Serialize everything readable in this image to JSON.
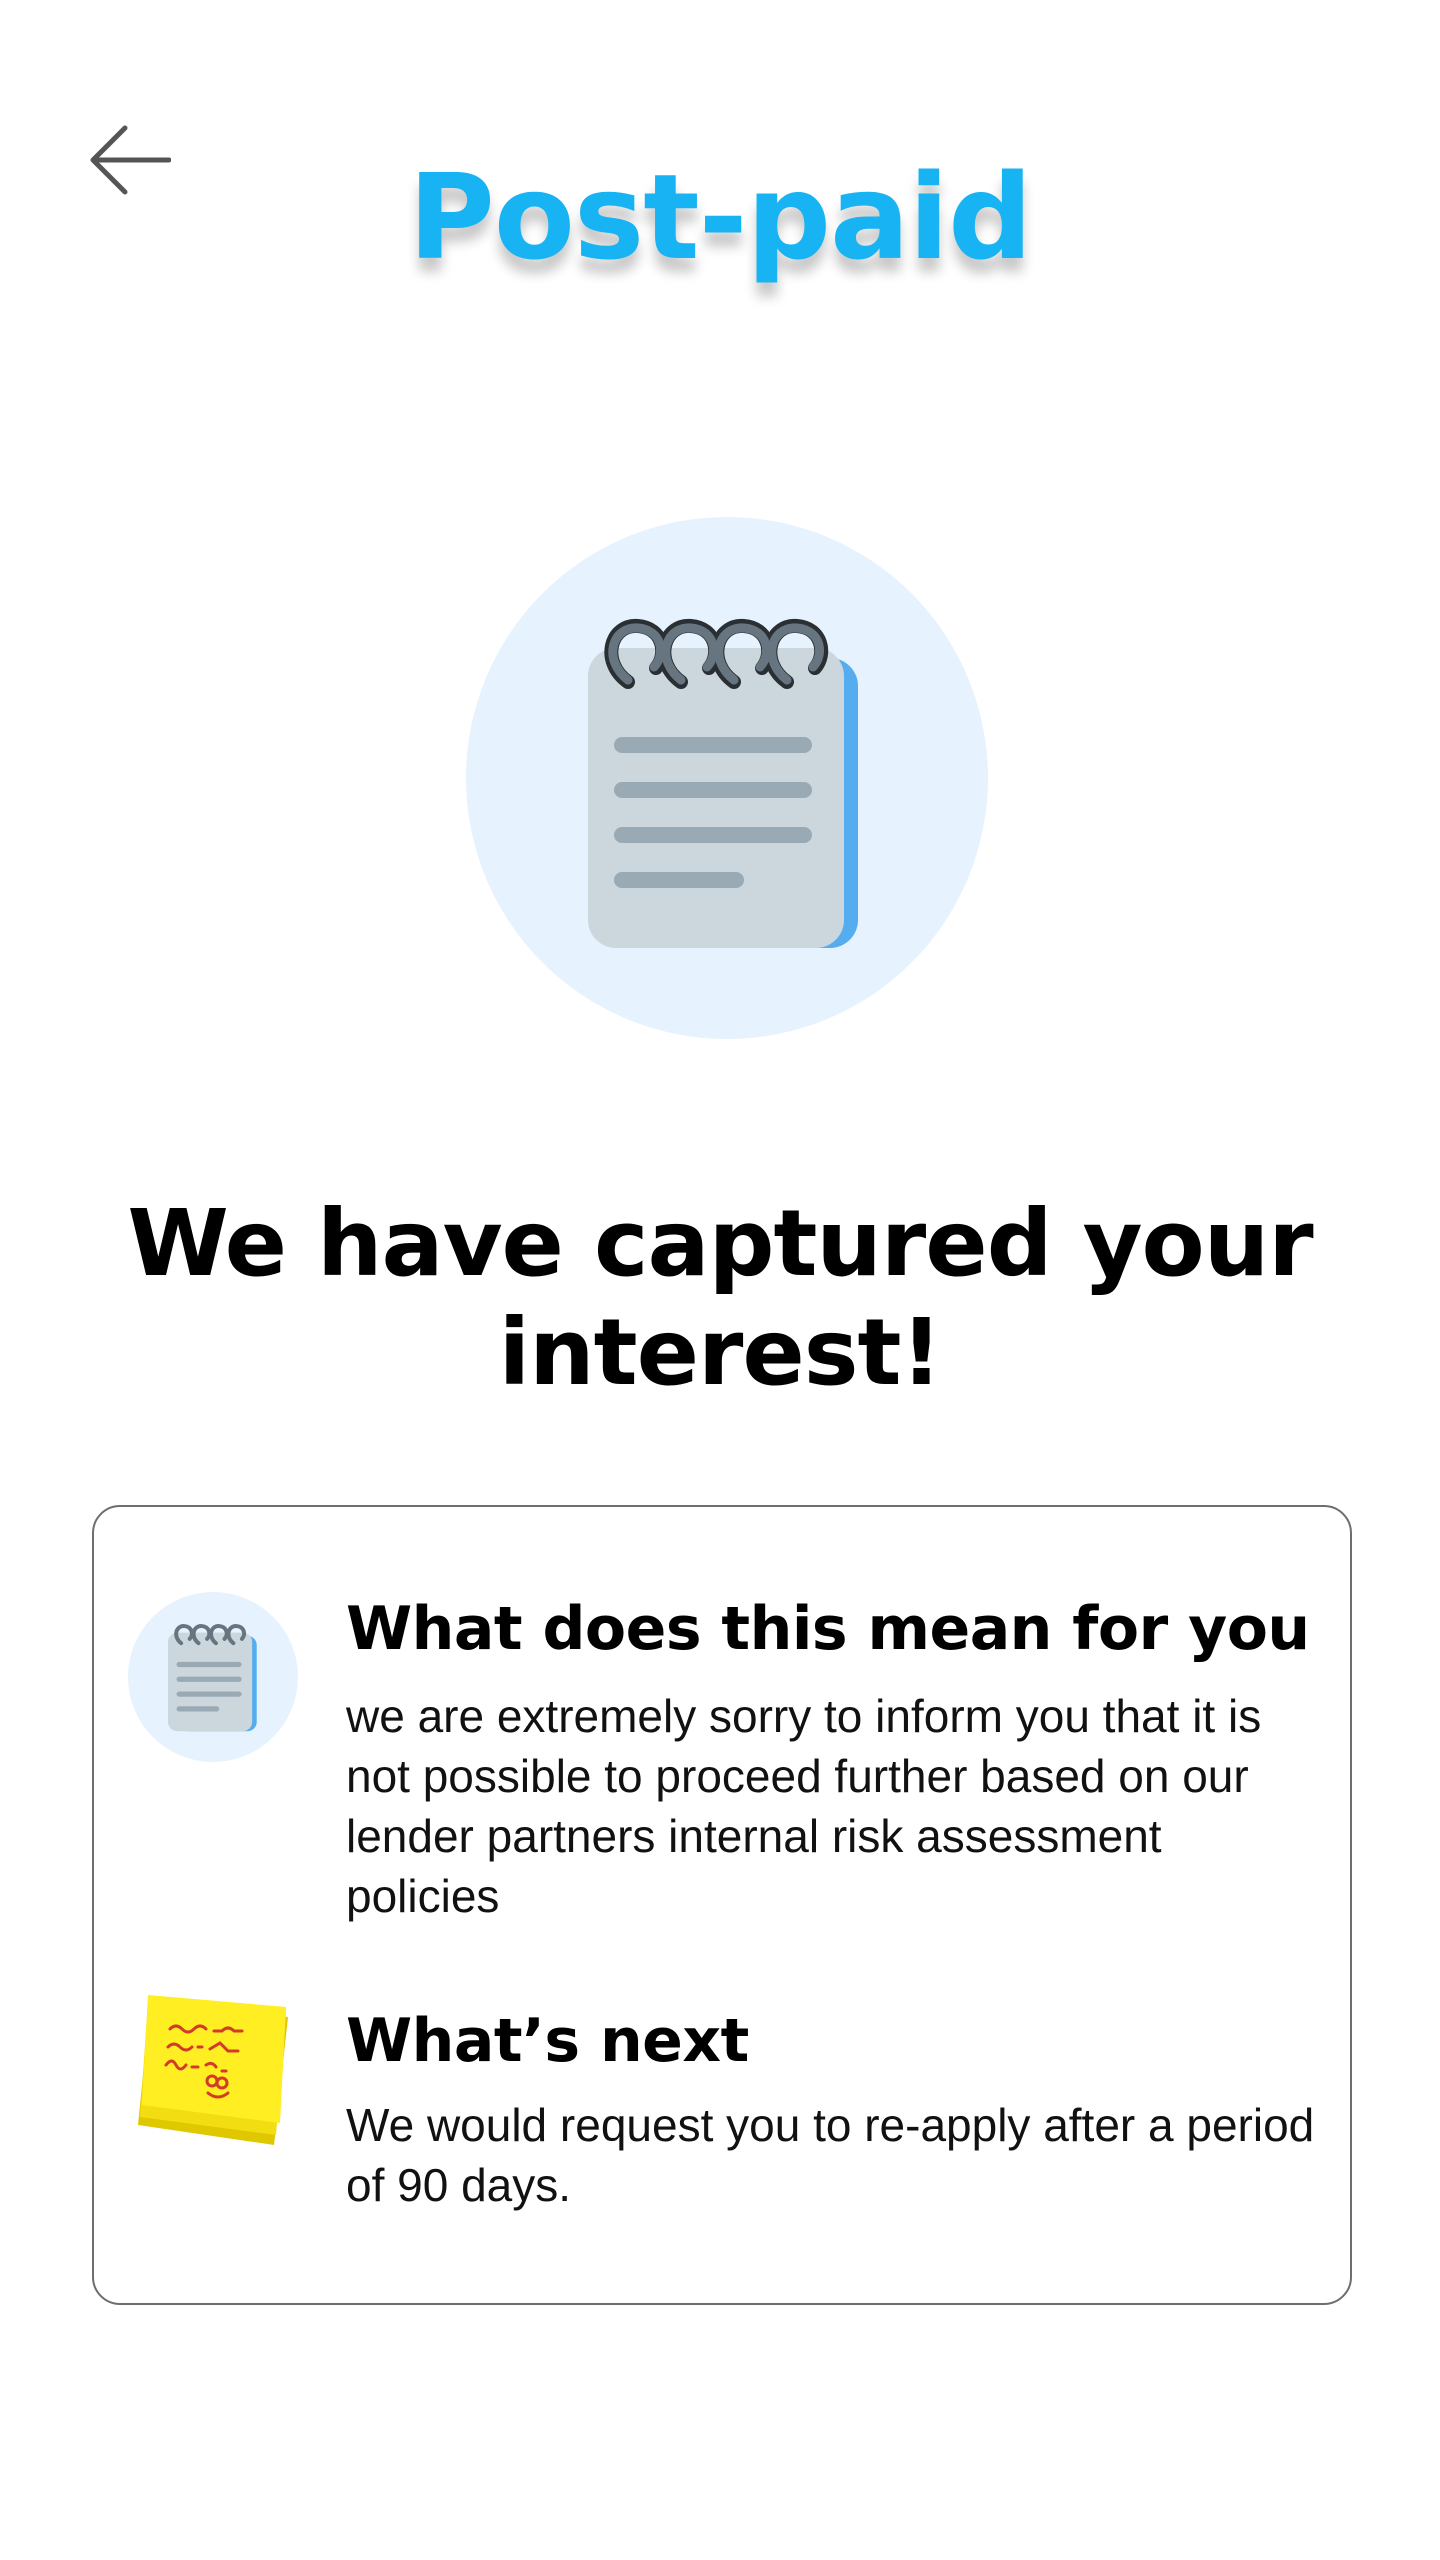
{
  "header": {
    "back_icon": "arrow-left-icon",
    "title": "Post-paid"
  },
  "hero": {
    "icon": "notepad-icon",
    "headline": "We have captured your interest!"
  },
  "info_card": {
    "items": [
      {
        "icon": "notepad-icon",
        "title": "What does this mean for you",
        "body": "we are extremely sorry to inform you that it is not possible to proceed further based on our lender partners internal risk assessment policies"
      },
      {
        "icon": "sticky-note-icon",
        "title": "What’s next",
        "body": "We would request you to re-apply after a period of 90 days."
      }
    ]
  },
  "colors": {
    "title_blue": "#18b3f2",
    "icon_circle_bg": "#e6f2fd",
    "card_border": "#6e6e6e"
  }
}
